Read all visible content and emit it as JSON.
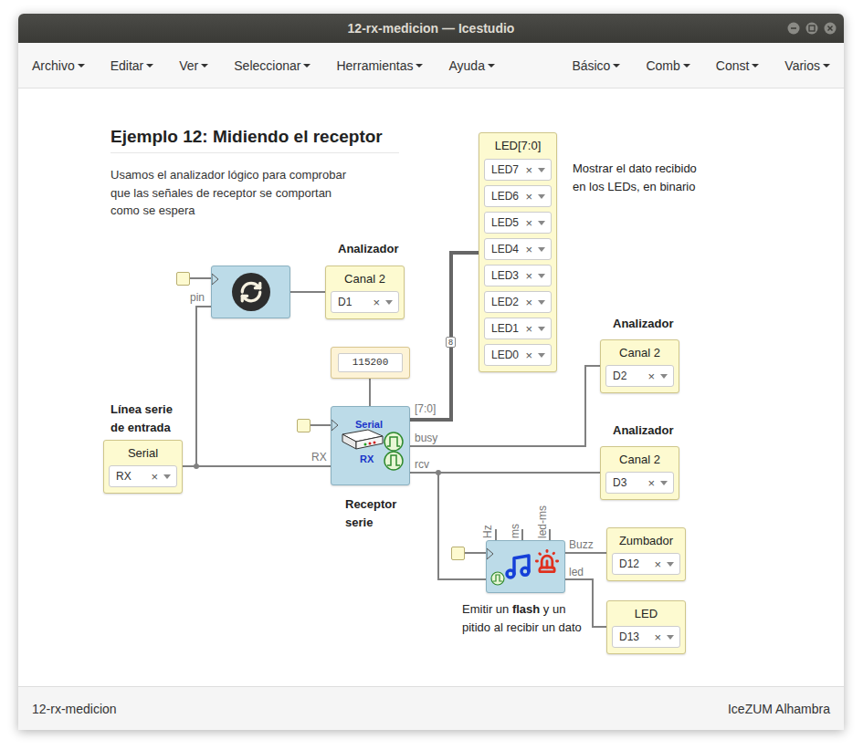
{
  "window": {
    "title": "12-rx-medicion — Icestudio"
  },
  "menubar": {
    "left": [
      "Archivo",
      "Editar",
      "Ver",
      "Seleccionar",
      "Herramientas",
      "Ayuda"
    ],
    "right": [
      "Básico",
      "Comb",
      "Const",
      "Varios"
    ]
  },
  "diagram": {
    "title": "Ejemplo 12: Midiendo el receptor",
    "description": [
      "Usamos el analizador lógico para comprobar",
      "que las señales de receptor se comportan",
      "como se espera"
    ],
    "select_clear": "×",
    "notes": [
      {
        "lines": [
          [
            {
              "text": "Analizador",
              "bold": true
            }
          ]
        ]
      },
      {
        "lines": [
          [
            {
              "text": "Analizador",
              "bold": true
            }
          ]
        ]
      },
      {
        "lines": [
          [
            {
              "text": "Analizador",
              "bold": true
            }
          ]
        ]
      },
      {
        "lines": [
          [
            {
              "text": "Línea serie",
              "bold": true
            }
          ],
          [
            {
              "text": "de entrada",
              "bold": true
            }
          ]
        ]
      },
      {
        "lines": [
          [
            {
              "text": "Receptor",
              "bold": true
            }
          ],
          [
            {
              "text": "serie",
              "bold": true
            }
          ]
        ]
      },
      {
        "lines": [
          [
            {
              "text": "Mostrar el dato recibido",
              "bold": false
            }
          ],
          [
            {
              "text": "en los LEDs, en binario",
              "bold": false
            }
          ]
        ]
      },
      {
        "lines": [
          [
            {
              "text": "Emitir un ",
              "bold": false
            },
            {
              "text": "flash",
              "bold": true
            },
            {
              "text": " y un",
              "bold": false
            }
          ],
          [
            {
              "text": "pitido al recibir un dato",
              "bold": false
            }
          ]
        ]
      }
    ],
    "io_boxes": [
      {
        "label": "Canal 2",
        "value": "D1"
      },
      {
        "label": "Canal 2",
        "value": "D2"
      },
      {
        "label": "Canal 2",
        "value": "D3"
      },
      {
        "label": "Serial",
        "value": "RX"
      },
      {
        "label": "Zumbador",
        "value": "D12"
      },
      {
        "label": "LED",
        "value": "D13"
      }
    ],
    "led_bus": {
      "label": "LED[7:0]",
      "values": [
        "LED7",
        "LED6",
        "LED5",
        "LED4",
        "LED3",
        "LED2",
        "LED1",
        "LED0"
      ]
    },
    "constant": {
      "value": "115200"
    },
    "sync_block": {
      "input": "pin"
    },
    "receiver_block": {
      "title": "Serial",
      "subtitle": "RX",
      "input": "RX",
      "outputs": [
        "[7:0]",
        "busy",
        "rcv"
      ]
    },
    "buzzer_block": {
      "params": [
        "Hz",
        "ms",
        "led-ms"
      ],
      "outputs": [
        "Buzz",
        "led"
      ]
    },
    "bus_width": "8"
  },
  "status_bar": {
    "file": "12-rx-medicion",
    "board": "IceZUM Alhambra"
  }
}
